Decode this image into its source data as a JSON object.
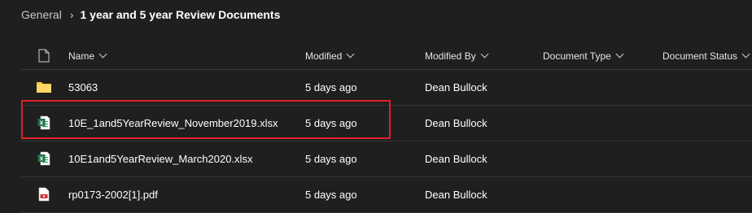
{
  "breadcrumb": {
    "root": "General",
    "current": "1 year and 5 year Review Documents"
  },
  "columns": {
    "name": "Name",
    "modified": "Modified",
    "modified_by": "Modified By",
    "document_type": "Document Type",
    "document_status": "Document Status"
  },
  "rows": [
    {
      "icon": "folder-icon",
      "name": "53063",
      "modified": "5 days ago",
      "modified_by": "Dean Bullock"
    },
    {
      "icon": "excel-file-icon",
      "name": "10E_1and5YearReview_November2019.xlsx",
      "modified": "5 days ago",
      "modified_by": "Dean Bullock"
    },
    {
      "icon": "excel-file-icon",
      "name": "10E1and5YearReview_March2020.xlsx",
      "modified": "5 days ago",
      "modified_by": "Dean Bullock"
    },
    {
      "icon": "pdf-file-icon",
      "name": "rp0173-2002[1].pdf",
      "modified": "5 days ago",
      "modified_by": "Dean Bullock"
    }
  ],
  "colors": {
    "background": "#1f1f1f",
    "highlight": "#e0202a",
    "excel": "#1e7145",
    "folder": "#ffc83d",
    "pdf": "#d13438"
  }
}
